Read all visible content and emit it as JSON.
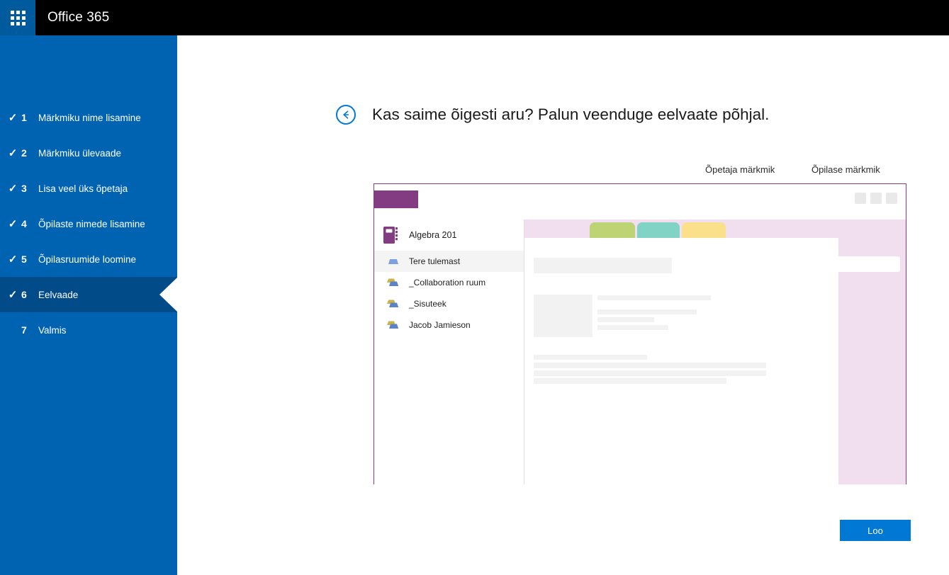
{
  "suite": {
    "app_launcher_icon": "waffle-grid-icon",
    "title": "Office 365"
  },
  "sidebar": {
    "accent_color": "#0063b1",
    "active_color": "#004b88",
    "steps": [
      {
        "number": "1",
        "label": "Märkmiku nime lisamine",
        "check": "✓",
        "state": "done"
      },
      {
        "number": "2",
        "label": "Märkmiku ülevaade",
        "check": "✓",
        "state": "done"
      },
      {
        "number": "3",
        "label": "Lisa veel üks õpetaja",
        "check": "✓",
        "state": "done"
      },
      {
        "number": "4",
        "label": "Õpilaste nimede lisamine",
        "check": "✓",
        "state": "done"
      },
      {
        "number": "5",
        "label": "Õpilasruumide loomine",
        "check": "✓",
        "state": "done"
      },
      {
        "number": "6",
        "label": "Eelvaade",
        "check": "✓",
        "state": "active"
      },
      {
        "number": "7",
        "label": "Valmis",
        "check": "",
        "state": "pending"
      }
    ]
  },
  "main": {
    "back_icon": "back-arrow-icon",
    "title": "Kas saime õigesti aru? Palun veenduge eelvaate põhjal.",
    "preview_tabs": [
      {
        "label": "Õpetaja märkmik"
      },
      {
        "label": "Õpilase märkmik"
      }
    ],
    "create_button": "Loo",
    "accent_color": "#0078d4"
  },
  "preview": {
    "border_color": "#8b3a7e",
    "title_block_color": "#833b82",
    "notebook_icon": "notebook-icon",
    "notebook_name": "Algebra 201",
    "window_controls": [
      "minimize-box",
      "maximize-box",
      "close-box"
    ],
    "nav_items": [
      {
        "label": "Tere tulemast",
        "icon": "section-icon",
        "selected": true
      },
      {
        "label": "_Collaboration ruum",
        "icon": "section-group-icon",
        "selected": false
      },
      {
        "label": "_Sisuteek",
        "icon": "section-group-icon",
        "selected": false
      },
      {
        "label": "Jacob Jamieson",
        "icon": "section-group-icon",
        "selected": false
      }
    ],
    "section_tabs": [
      {
        "color": "#f1dff0",
        "active": true
      },
      {
        "color": "#bdd474",
        "active": false
      },
      {
        "color": "#81d3c5",
        "active": false
      },
      {
        "color": "#fbe08b",
        "active": false
      }
    ]
  }
}
